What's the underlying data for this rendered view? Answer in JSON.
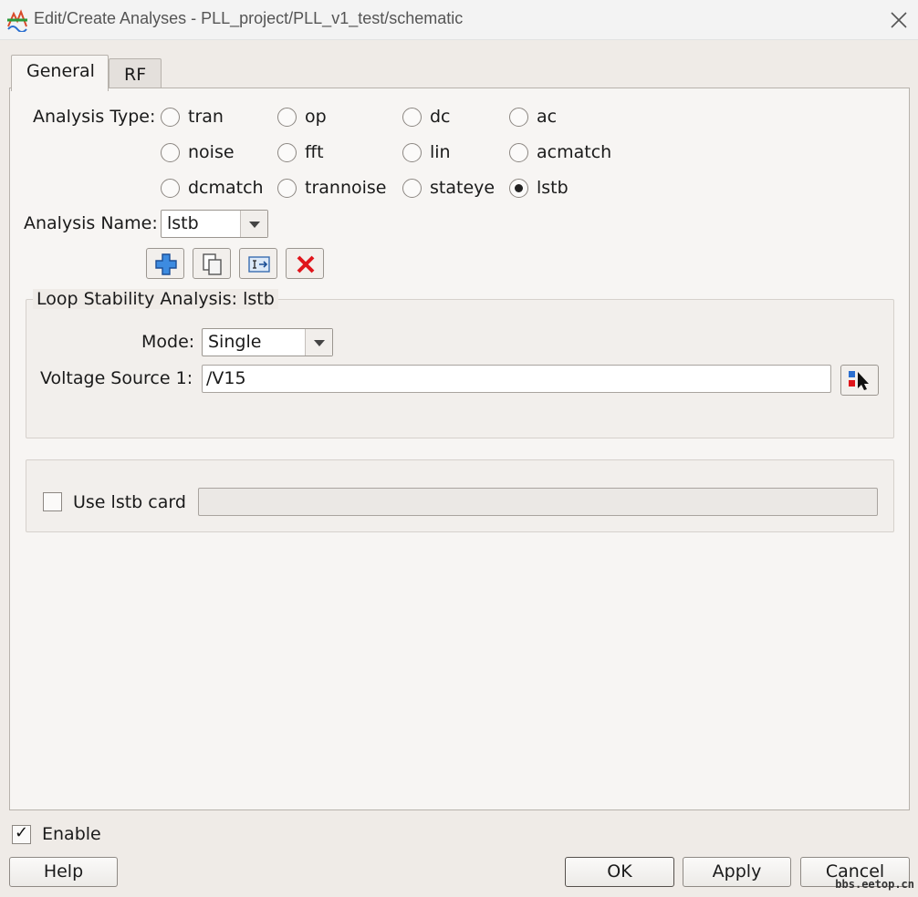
{
  "window": {
    "title": "Edit/Create Analyses - PLL_project/PLL_v1_test/schematic"
  },
  "tabs": [
    {
      "label": "General"
    },
    {
      "label": "RF"
    }
  ],
  "analysis_type": {
    "label": "Analysis Type:",
    "options": [
      "tran",
      "op",
      "dc",
      "ac",
      "noise",
      "fft",
      "lin",
      "acmatch",
      "dcmatch",
      "trannoise",
      "stateye",
      "lstb"
    ],
    "selected": "lstb"
  },
  "analysis_name": {
    "label": "Analysis Name:",
    "value": "lstb"
  },
  "toolbar": {
    "icons": [
      "add-icon",
      "copy-icon",
      "rename-icon",
      "delete-icon"
    ]
  },
  "lstb_group": {
    "title": "Loop Stability Analysis: lstb",
    "mode_label": "Mode:",
    "mode_value": "Single",
    "vsource_label": "Voltage Source 1:",
    "vsource_value": "/V15"
  },
  "lstb_card": {
    "label": "Use lstb card",
    "checked": false,
    "value": ""
  },
  "enable": {
    "label": "Enable",
    "checked": true
  },
  "buttons": {
    "help": "Help",
    "ok": "OK",
    "apply": "Apply",
    "cancel": "Cancel"
  },
  "watermark": "bbs.eetop.cn"
}
